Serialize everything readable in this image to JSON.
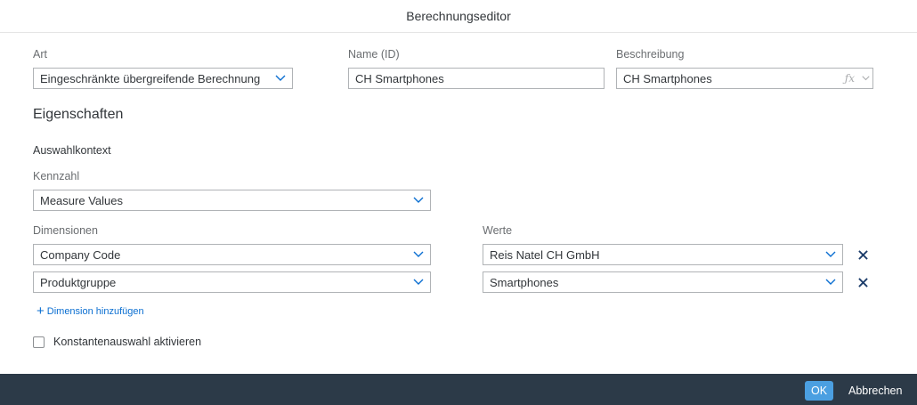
{
  "dialog": {
    "title": "Berechnungseditor"
  },
  "art": {
    "label": "Art",
    "value": "Eingeschränkte übergreifende Berechnung"
  },
  "name": {
    "label": "Name (ID)",
    "value": "CH Smartphones"
  },
  "beschreibung": {
    "label": "Beschreibung",
    "value": "CH Smartphones",
    "fx_icon": "ƒx"
  },
  "eigenschaften": {
    "heading": "Eigenschaften",
    "context_label": "Auswahlkontext"
  },
  "kennzahl": {
    "label": "Kennzahl",
    "value": "Measure Values"
  },
  "dimensionen": {
    "label": "Dimensionen",
    "values_label": "Werte",
    "rows": [
      {
        "dimension": "Company Code",
        "value": "Reis Natel CH GmbH"
      },
      {
        "dimension": "Produktgruppe",
        "value": "Smartphones"
      }
    ],
    "add_label": "Dimension hinzufügen"
  },
  "constant": {
    "label": "Konstantenauswahl aktivieren",
    "checked": false
  },
  "footer": {
    "ok_label": "OK",
    "cancel_label": "Abbrechen"
  },
  "colors": {
    "accent": "#0a6ed1",
    "footer_bg": "#2c3a48",
    "ok_bg": "#4b9fe1",
    "remove_icon": "#1d3d6b"
  }
}
